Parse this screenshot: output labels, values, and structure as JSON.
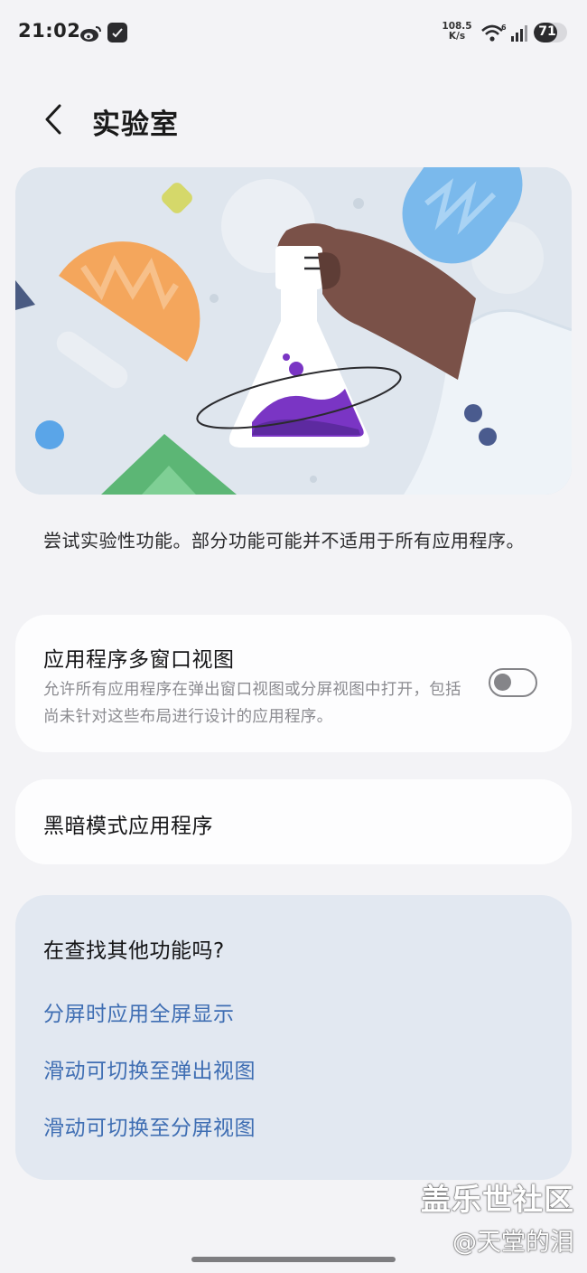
{
  "status_bar": {
    "time": "21:02",
    "net_speed_value": "108.5",
    "net_speed_unit": "K/s",
    "battery": "71",
    "battery_level": 0.71,
    "icons": [
      "weibo-icon",
      "app-notification-icon",
      "wifi-icon",
      "signal-icon",
      "signal-icon",
      "battery-icon"
    ]
  },
  "header": {
    "back_icon": "chevron-left-icon",
    "title": "实验室"
  },
  "hero": {
    "illustration": "lab-flask-illustration"
  },
  "description": "尝试实验性功能。部分功能可能并不适用于所有应用程序。",
  "settings": {
    "multiwindow": {
      "title": "应用程序多窗口视图",
      "subtitle": "允许所有应用程序在弹出窗口视图或分屏视图中打开，包括尚未针对这些布局进行设计的应用程序。",
      "enabled": false
    },
    "dark_mode_apps": {
      "title": "黑暗模式应用程序"
    }
  },
  "more": {
    "title": "在查找其他功能吗?",
    "links": [
      "分屏时应用全屏显示",
      "滑动可切换至弹出视图",
      "滑动可切换至分屏视图"
    ]
  },
  "watermark": {
    "line1": "盖乐世社区",
    "line2": "@天堂的泪"
  },
  "colors": {
    "background": "#f3f3f6",
    "card": "#fdfdfe",
    "more_card": "#e2e8f1",
    "link": "#3f6eb3",
    "flask_liquid": "#7a35c4"
  }
}
